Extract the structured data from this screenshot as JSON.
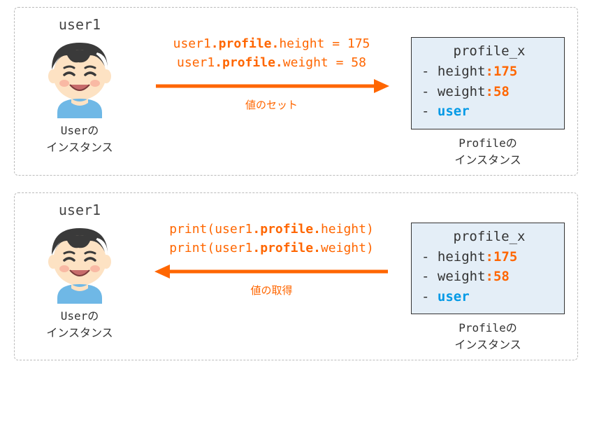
{
  "panel1": {
    "user_label": "user1",
    "user_instance_class": "User",
    "user_instance_suffix": "の",
    "user_instance_text": "インスタンス",
    "code_line1_pre": "user1",
    "code_line1_dot1": ".",
    "code_line1_mid": "profile",
    "code_line1_dot2": ".",
    "code_line1_tail": "height = 175",
    "code_line2_pre": "user1",
    "code_line2_dot1": ".",
    "code_line2_mid": "profile",
    "code_line2_dot2": ".",
    "code_line2_tail": "weight = 58",
    "arrow_label": "値のセット",
    "obj_title": "profile_x",
    "row1_key": "- height",
    "row1_colon": ":",
    "row1_val": "175",
    "row2_key": "- weight",
    "row2_colon": ":",
    "row2_val": "58",
    "row3_dash": "- ",
    "row3_val": "user",
    "profile_instance_class": "Profile",
    "profile_instance_suffix": "の",
    "profile_instance_text": "インスタンス"
  },
  "panel2": {
    "user_label": "user1",
    "user_instance_class": "User",
    "user_instance_suffix": "の",
    "user_instance_text": "インスタンス",
    "code_line1_pre": "print(user1",
    "code_line1_dot1": ".",
    "code_line1_mid": "profile",
    "code_line1_dot2": ".",
    "code_line1_tail": "height)",
    "code_line2_pre": "print(user1",
    "code_line2_dot1": ".",
    "code_line2_mid": "profile",
    "code_line2_dot2": ".",
    "code_line2_tail": "weight)",
    "arrow_label": "値の取得",
    "obj_title": "profile_x",
    "row1_key": "- height",
    "row1_colon": ":",
    "row1_val": "175",
    "row2_key": "- weight",
    "row2_colon": ":",
    "row2_val": "58",
    "row3_dash": "- ",
    "row3_val": "user",
    "profile_instance_class": "Profile",
    "profile_instance_suffix": "の",
    "profile_instance_text": "インスタンス"
  }
}
